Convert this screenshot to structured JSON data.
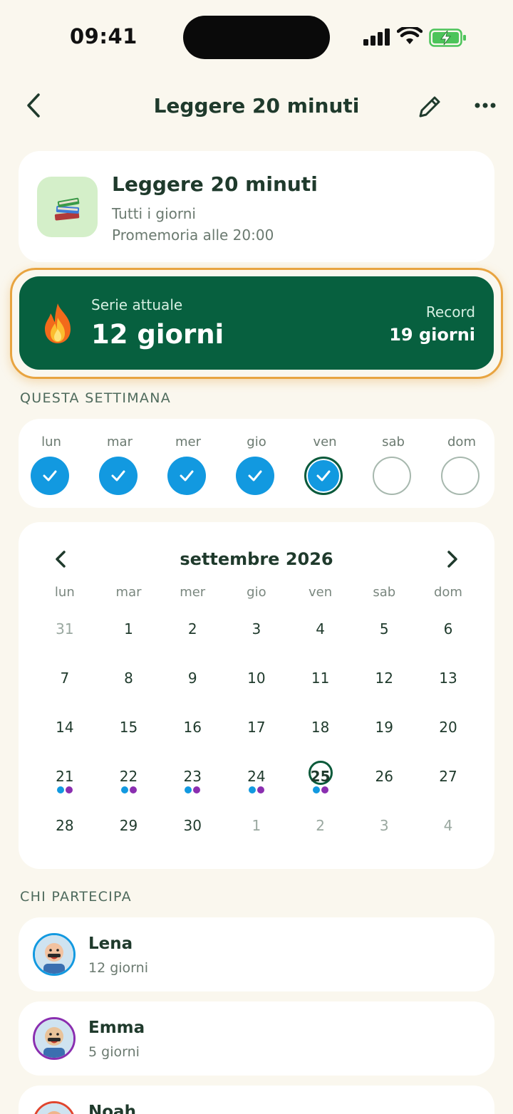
{
  "status_bar": {
    "time": "09:41"
  },
  "nav": {
    "title": "Leggere 20 minuti"
  },
  "habit": {
    "title": "Leggere 20 minuti",
    "frequency": "Tutti i giorni",
    "reminder": "Promemoria alle 20:00",
    "icon": "books-icon"
  },
  "streak": {
    "current_label": "Serie attuale",
    "current_value": "12 giorni",
    "record_label": "Record",
    "record_value": "19 giorni"
  },
  "week": {
    "section_label": "QUESTA SETTIMANA",
    "days": [
      {
        "label": "lun",
        "state": "done"
      },
      {
        "label": "mar",
        "state": "done"
      },
      {
        "label": "mer",
        "state": "done"
      },
      {
        "label": "gio",
        "state": "done"
      },
      {
        "label": "ven",
        "state": "today"
      },
      {
        "label": "sab",
        "state": "empty"
      },
      {
        "label": "dom",
        "state": "empty"
      }
    ]
  },
  "calendar": {
    "title": "settembre 2026",
    "weekdays": [
      "lun",
      "mar",
      "mer",
      "gio",
      "ven",
      "sab",
      "dom"
    ],
    "weeks": [
      [
        {
          "d": "31",
          "muted": true
        },
        {
          "d": "1"
        },
        {
          "d": "2"
        },
        {
          "d": "3"
        },
        {
          "d": "4"
        },
        {
          "d": "5"
        },
        {
          "d": "6"
        }
      ],
      [
        {
          "d": "7"
        },
        {
          "d": "8"
        },
        {
          "d": "9"
        },
        {
          "d": "10"
        },
        {
          "d": "11"
        },
        {
          "d": "12"
        },
        {
          "d": "13"
        }
      ],
      [
        {
          "d": "14"
        },
        {
          "d": "15"
        },
        {
          "d": "16"
        },
        {
          "d": "17"
        },
        {
          "d": "18"
        },
        {
          "d": "19"
        },
        {
          "d": "20"
        }
      ],
      [
        {
          "d": "21",
          "dots": true
        },
        {
          "d": "22",
          "dots": true
        },
        {
          "d": "23",
          "dots": true
        },
        {
          "d": "24",
          "dots": true
        },
        {
          "d": "25",
          "dots": true,
          "today": true
        },
        {
          "d": "26"
        },
        {
          "d": "27"
        }
      ],
      [
        {
          "d": "28"
        },
        {
          "d": "29"
        },
        {
          "d": "30"
        },
        {
          "d": "1",
          "muted": true
        },
        {
          "d": "2",
          "muted": true
        },
        {
          "d": "3",
          "muted": true
        },
        {
          "d": "4",
          "muted": true
        }
      ]
    ]
  },
  "participants": {
    "section_label": "CHI PARTECIPA",
    "people": [
      {
        "name": "Lena",
        "days": "12 giorni",
        "ring": "#1299e0"
      },
      {
        "name": "Emma",
        "days": "5 giorni",
        "ring": "#8a2eb0"
      },
      {
        "name": "Noah",
        "days": "",
        "ring": "#e0452e"
      }
    ]
  },
  "colors": {
    "accent_green": "#07603f",
    "check_blue": "#1299e0",
    "streak_outline": "#e8a440",
    "dot_purple": "#8a2eb0"
  }
}
